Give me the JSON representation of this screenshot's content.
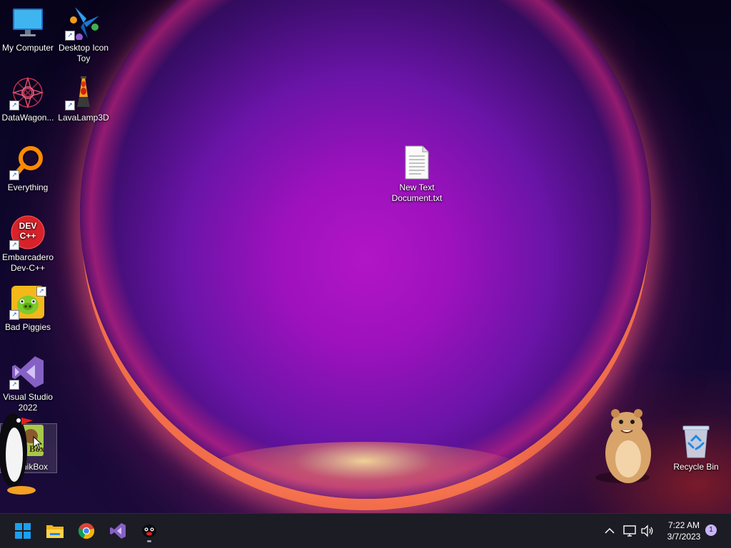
{
  "desktop": {
    "icons": [
      {
        "id": "my-computer",
        "label": "My Computer"
      },
      {
        "id": "desktop-icon-toy",
        "label": "Desktop Icon Toy"
      },
      {
        "id": "datawagon",
        "label": "DataWagon..."
      },
      {
        "id": "lavalamp",
        "label": "LavaLamp3D"
      },
      {
        "id": "everything",
        "label": "Everything"
      },
      {
        "id": "devcpp",
        "label": "Embarcadero Dev-C++"
      },
      {
        "id": "badpiggies",
        "label": "Bad Piggies"
      },
      {
        "id": "vs2022",
        "label": "Visual Studio 2022"
      },
      {
        "id": "nikbox",
        "label": "nikBox"
      },
      {
        "id": "newtext",
        "label": "New Text Document.txt"
      },
      {
        "id": "recyclebin",
        "label": "Recycle Bin"
      }
    ],
    "devcpp_logo_text": "DEV C++",
    "nikbox_logo_text": "Box"
  },
  "taskbar": {
    "apps": [
      "Start",
      "File Explorer",
      "Google Chrome",
      "Visual Studio",
      "Penguin app"
    ],
    "tray": {
      "time": "7:22 AM",
      "date": "3/7/2023",
      "notifications": "1"
    }
  },
  "colors": {
    "accent": "#0a84ff",
    "taskbar": "#1c1c24"
  }
}
